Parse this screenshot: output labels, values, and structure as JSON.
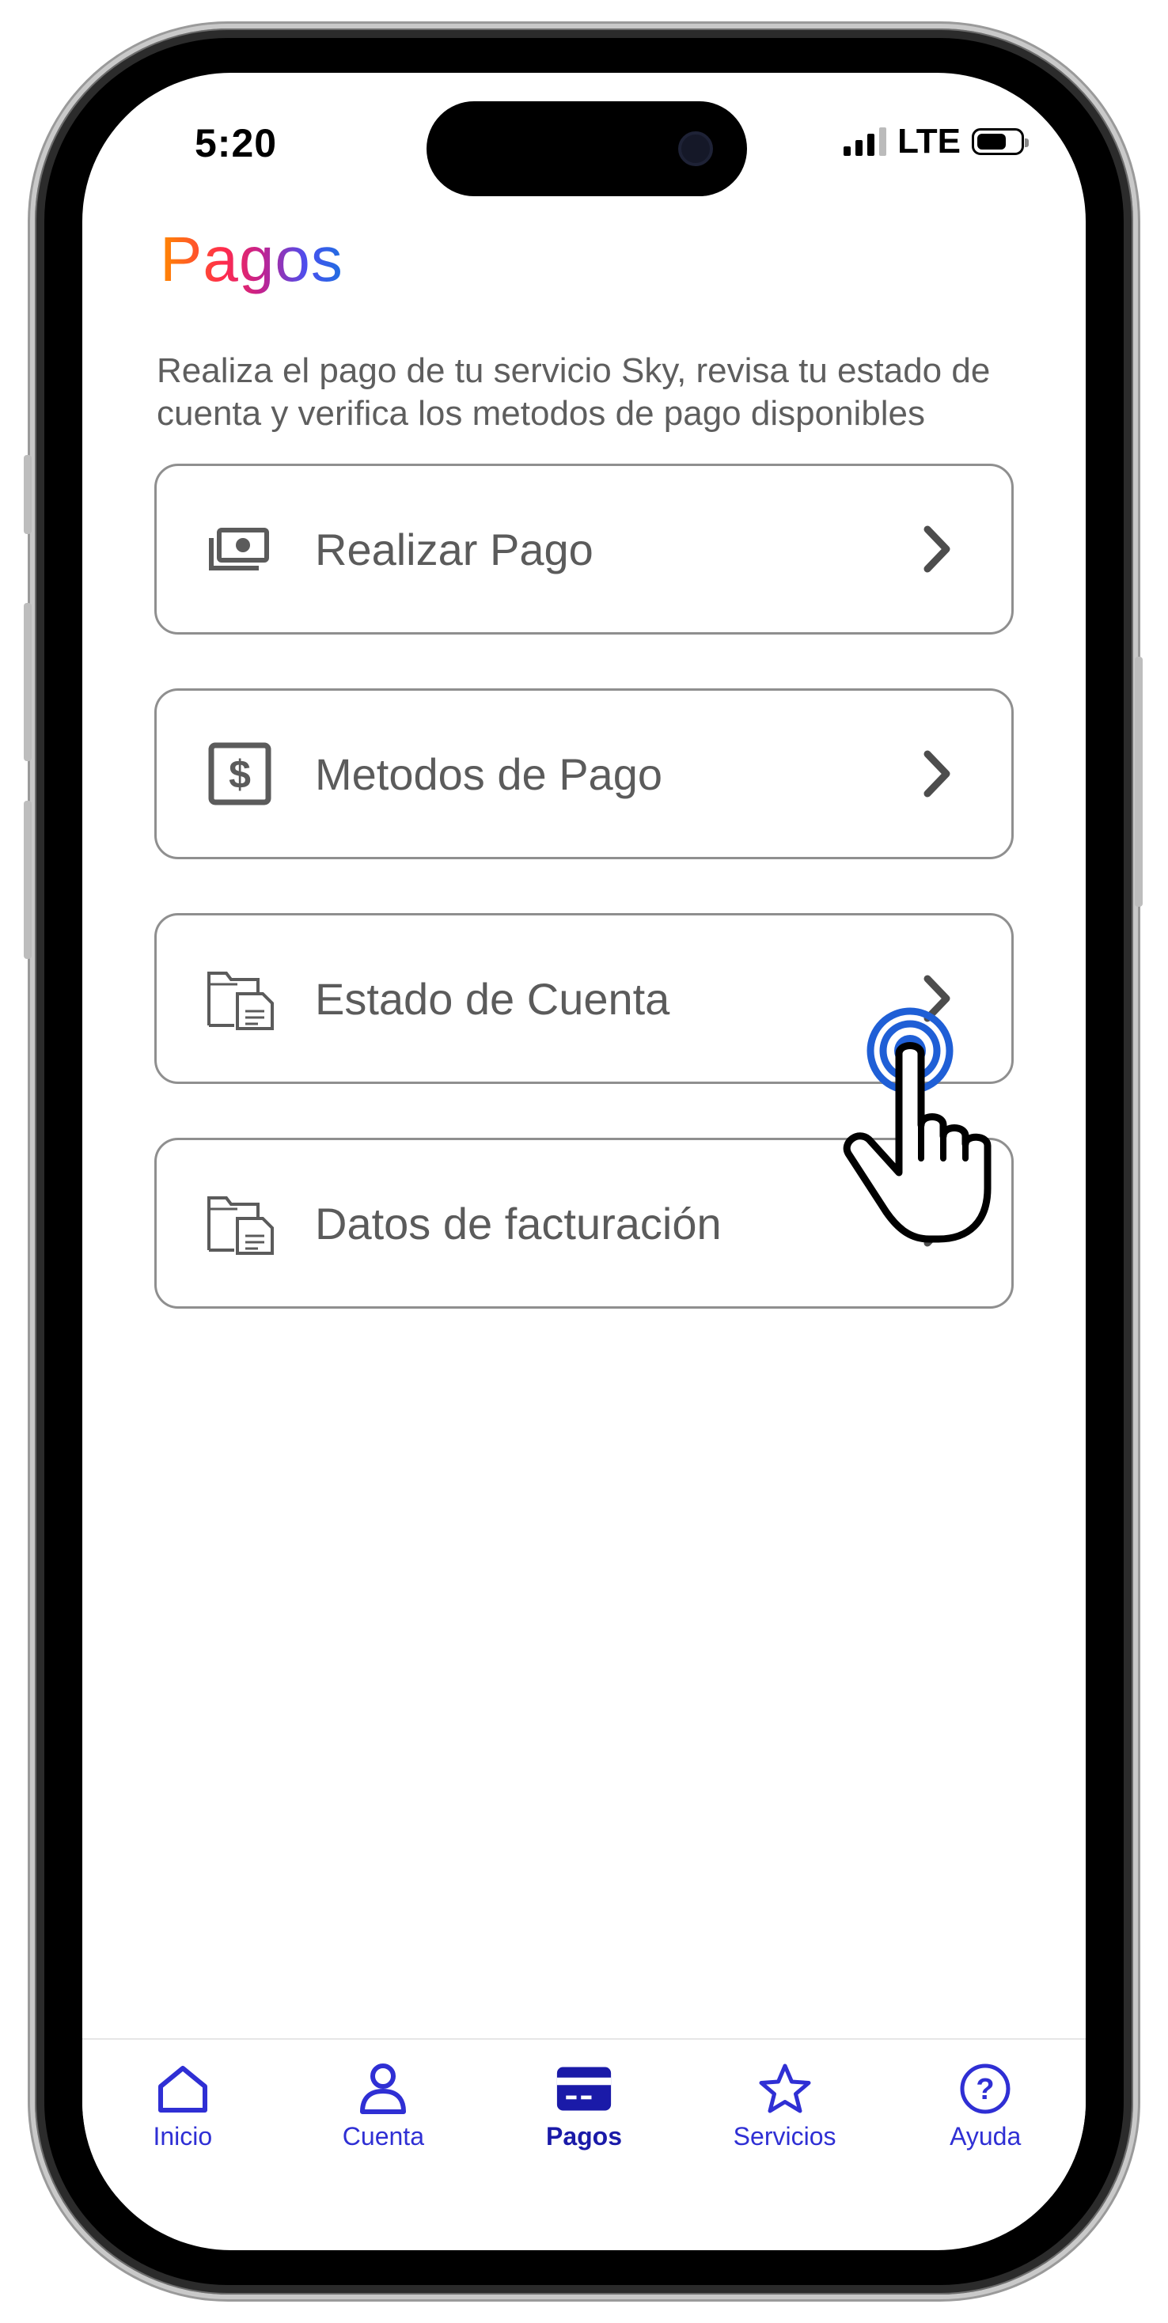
{
  "status_bar": {
    "time": "5:20",
    "network": "LTE"
  },
  "header": {
    "title": "Pagos",
    "subtitle": "Realiza el pago de tu servicio Sky, revisa tu estado de cuenta y verifica los metodos de pago disponibles"
  },
  "menu": {
    "items": [
      {
        "label": "Realizar Pago",
        "icon": "cash-icon"
      },
      {
        "label": "Metodos de Pago",
        "icon": "dollar-icon"
      },
      {
        "label": "Estado de Cuenta",
        "icon": "folder-document-icon"
      },
      {
        "label": "Datos de facturación",
        "icon": "folder-document-icon"
      }
    ]
  },
  "tab_bar": {
    "tabs": [
      {
        "label": "Inicio",
        "icon": "home-icon",
        "active": false
      },
      {
        "label": "Cuenta",
        "icon": "user-icon",
        "active": false
      },
      {
        "label": "Pagos",
        "icon": "card-icon",
        "active": true
      },
      {
        "label": "Servicios",
        "icon": "star-icon",
        "active": false
      },
      {
        "label": "Ayuda",
        "icon": "help-icon",
        "active": false
      }
    ]
  },
  "colors": {
    "accent_blue": "#2f2fd4",
    "text_gray": "#5b5b5b",
    "border_gray": "#8f8f8f",
    "touch_blue": "#1f5fd6"
  }
}
